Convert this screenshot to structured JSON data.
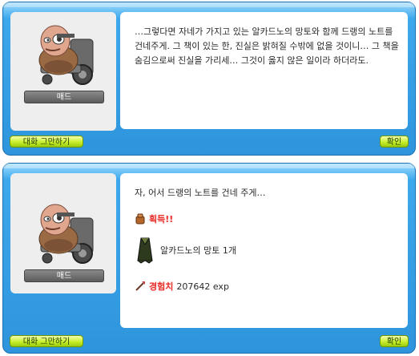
{
  "dialog1": {
    "npc_name": "매드",
    "text": "…그렇다면 자네가 가지고 있는 알카드노의 망토와 함께 드랭의 노트를 건네주게. 그 책이 있는 한, 진실은 밝혀질 수밖에 없을 것이니… 그 책을 숨김으로써 진실을 가리세… 그것이 옳지 않은 일이라 하더라도.",
    "end_chat_label": "대화 그만하기",
    "ok_label": "확인"
  },
  "dialog2": {
    "npc_name": "매드",
    "text": "자, 어서 드랭의 노트를 건네 주게…",
    "reward_label": "획득!!",
    "item_text": "알카드노의 망토 1개",
    "exp_label": "경험치",
    "exp_value": "207642 exp",
    "end_chat_label": "대화 그만하기",
    "ok_label": "확인"
  },
  "colors": {
    "frame": "#2e95dc",
    "button": "#c9ee2c",
    "reward_red": "#e8302c"
  },
  "icons": [
    "npc-portrait-icon",
    "bag-icon",
    "cape-icon",
    "exp-icon"
  ]
}
